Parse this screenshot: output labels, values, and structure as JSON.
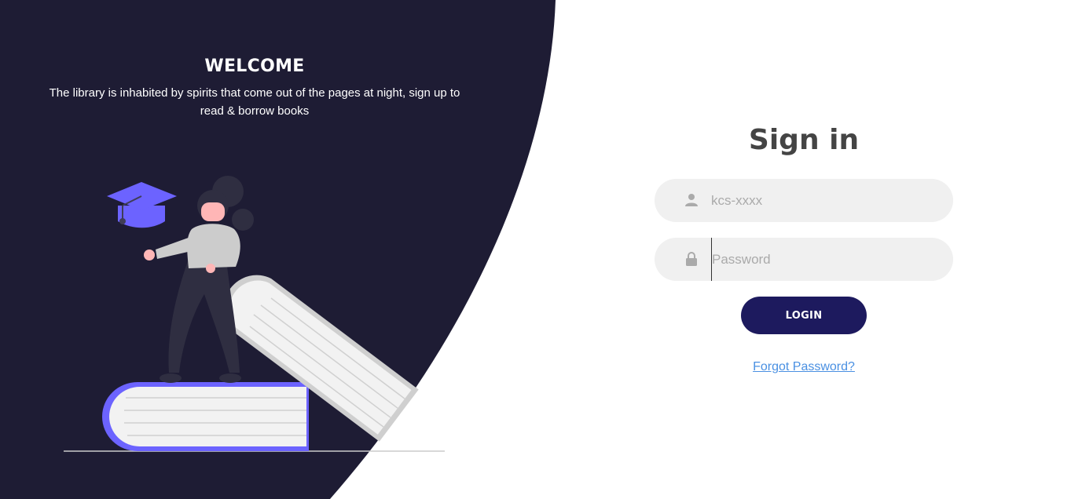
{
  "colors": {
    "dark_panel": "#1e1c34",
    "accent": "#6c63ff",
    "button": "#1d1a5e",
    "link": "#4a90e2",
    "field_bg": "#f0f0f0"
  },
  "welcome": {
    "title": "WELCOME",
    "subtitle": "The library is inhabited by spirits that come out of the pages at night, sign up to read & borrow books"
  },
  "signin": {
    "title": "Sign in",
    "username": {
      "icon": "user-icon",
      "placeholder": "kcs-xxxx",
      "value": ""
    },
    "password": {
      "icon": "lock-icon",
      "placeholder": "Password",
      "value": ""
    },
    "login_label": "LOGIN",
    "forgot_label": "Forgot Password?"
  }
}
